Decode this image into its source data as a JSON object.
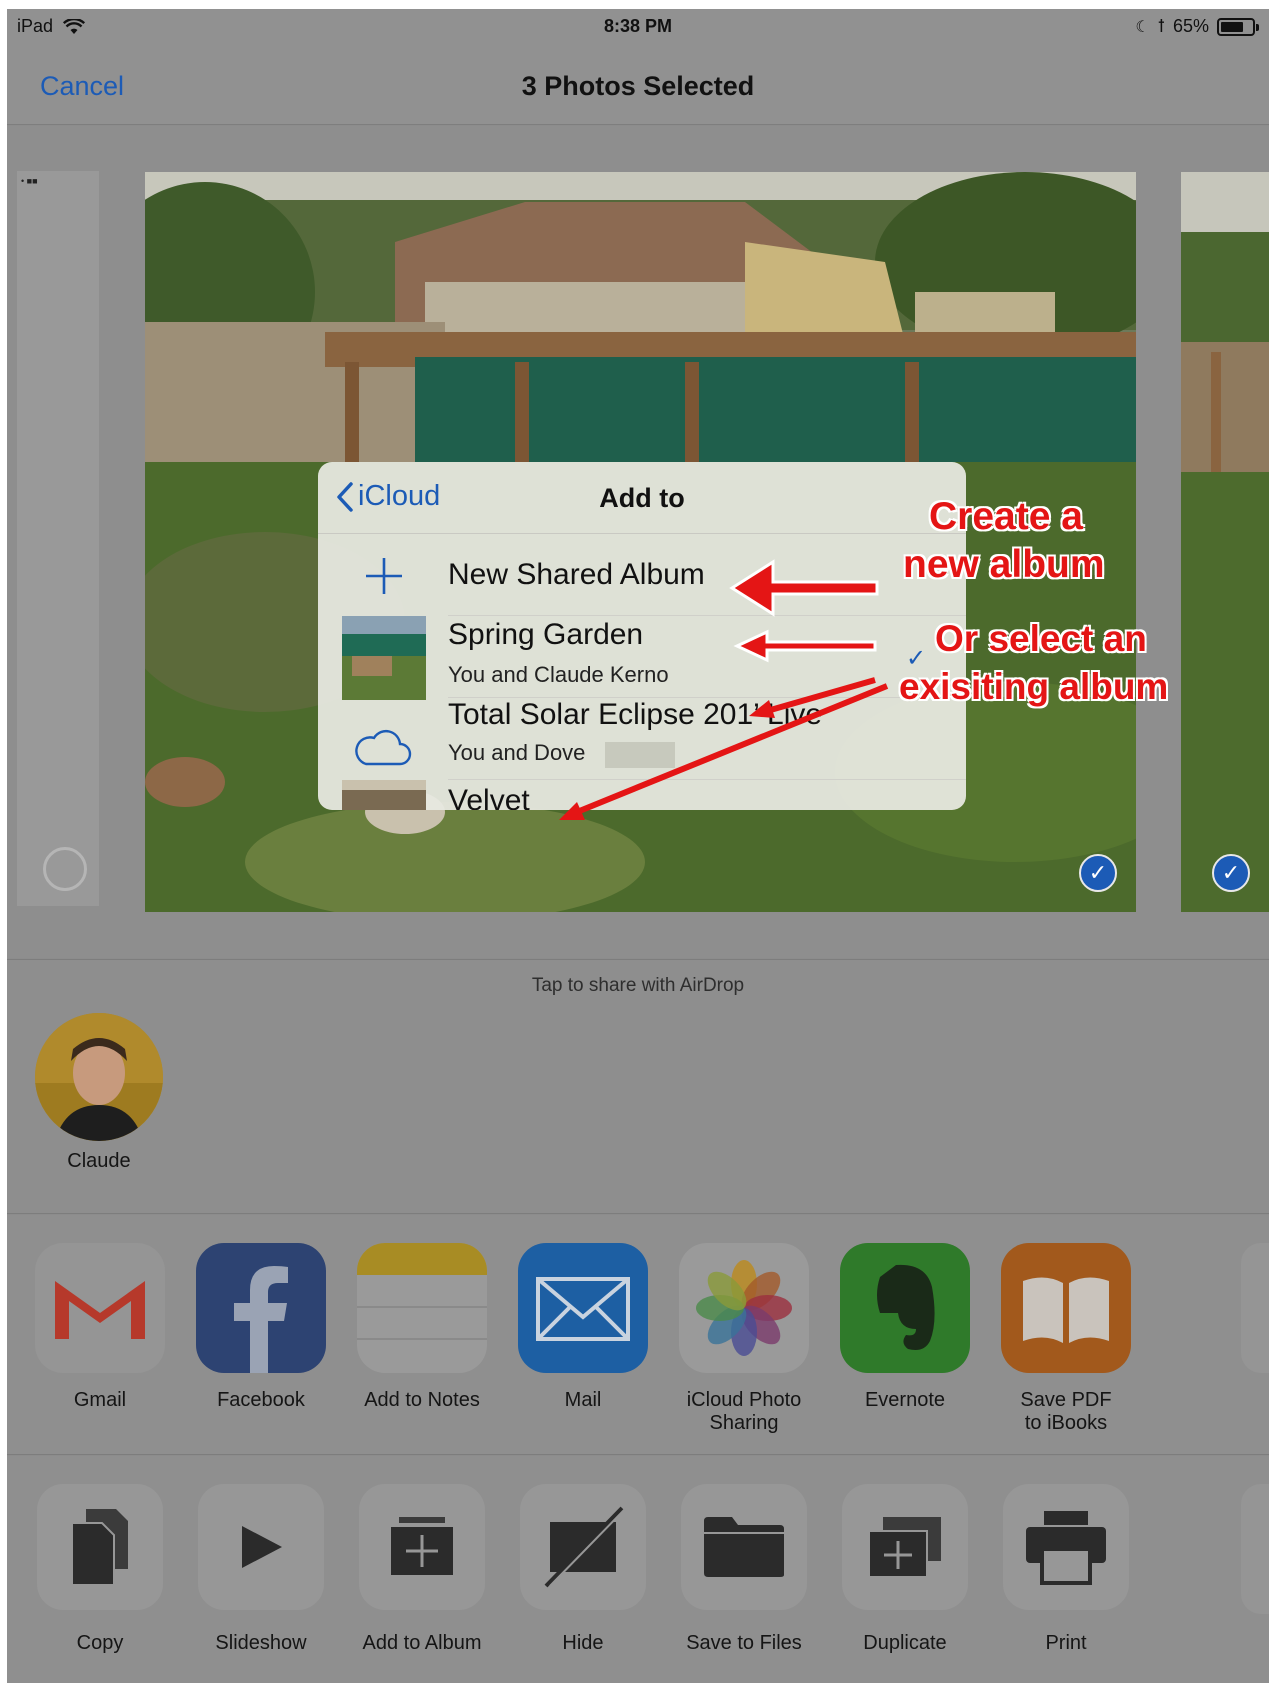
{
  "status_bar": {
    "device": "iPad",
    "time": "8:38 PM",
    "battery": "65%"
  },
  "nav": {
    "cancel_label": "Cancel",
    "title": "3 Photos Selected"
  },
  "popover": {
    "back_label": "iCloud",
    "title": "Add to",
    "albums": [
      {
        "name": "New Shared Album",
        "subtitle": ""
      },
      {
        "name": "Spring Garden",
        "subtitle": "You and Claude Kerno",
        "selected": true
      },
      {
        "name": "Total Solar Eclipse 201’ Live",
        "subtitle": "You and Dove"
      },
      {
        "name": "Velvet",
        "subtitle": ""
      }
    ]
  },
  "annotations": {
    "create_line1": "Create a",
    "create_line2": "new album",
    "select_line1": "Or select an",
    "select_line2": "exisiting album",
    "color": "#e41515"
  },
  "airdrop": {
    "hint": "Tap to share with AirDrop",
    "contacts": [
      {
        "name": "Claude"
      }
    ]
  },
  "share_apps": [
    {
      "label": "Gmail",
      "icon": "gmail-icon"
    },
    {
      "label": "Facebook",
      "icon": "facebook-icon"
    },
    {
      "label": "Add to Notes",
      "icon": "notes-icon"
    },
    {
      "label": "Mail",
      "icon": "mail-icon"
    },
    {
      "label": "iCloud Photo\nSharing",
      "icon": "photos-icon"
    },
    {
      "label": "Evernote",
      "icon": "evernote-icon"
    },
    {
      "label": "Save PDF\nto iBooks",
      "icon": "ibooks-icon"
    }
  ],
  "actions": [
    {
      "label": "Copy",
      "icon": "copy-icon"
    },
    {
      "label": "Slideshow",
      "icon": "play-icon"
    },
    {
      "label": "Add to Album",
      "icon": "add-to-album-icon"
    },
    {
      "label": "Hide",
      "icon": "hide-icon"
    },
    {
      "label": "Save to Files",
      "icon": "folder-icon"
    },
    {
      "label": "Duplicate",
      "icon": "duplicate-icon"
    },
    {
      "label": "Print",
      "icon": "printer-icon"
    }
  ],
  "colors": {
    "accent": "#1c5bb6",
    "dim_background": "#8e8e8e"
  }
}
